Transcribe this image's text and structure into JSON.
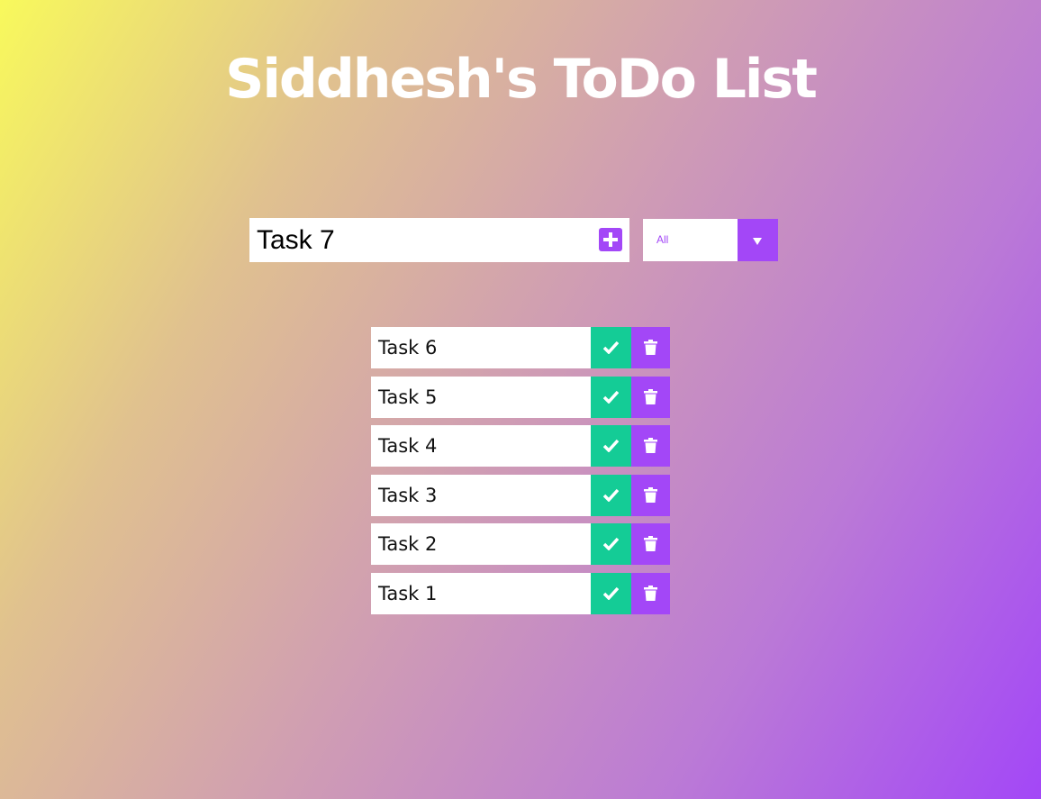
{
  "header": {
    "title": "Siddhesh's ToDo List"
  },
  "form": {
    "input_value": "Task 7",
    "add_icon": "plus-square-icon",
    "filter": {
      "selected": "All",
      "arrow_icon": "caret-down-icon"
    }
  },
  "todos": [
    {
      "label": "Task 6"
    },
    {
      "label": "Task 5"
    },
    {
      "label": "Task 4"
    },
    {
      "label": "Task 3"
    },
    {
      "label": "Task 2"
    },
    {
      "label": "Task 1"
    }
  ],
  "icons": {
    "complete": "check-icon",
    "delete": "trash-icon"
  },
  "colors": {
    "accent": "#a347f7",
    "complete": "#14cc96",
    "gradient_start": "#f8f95c",
    "gradient_end": "#a347f7",
    "title": "#ffffff"
  }
}
